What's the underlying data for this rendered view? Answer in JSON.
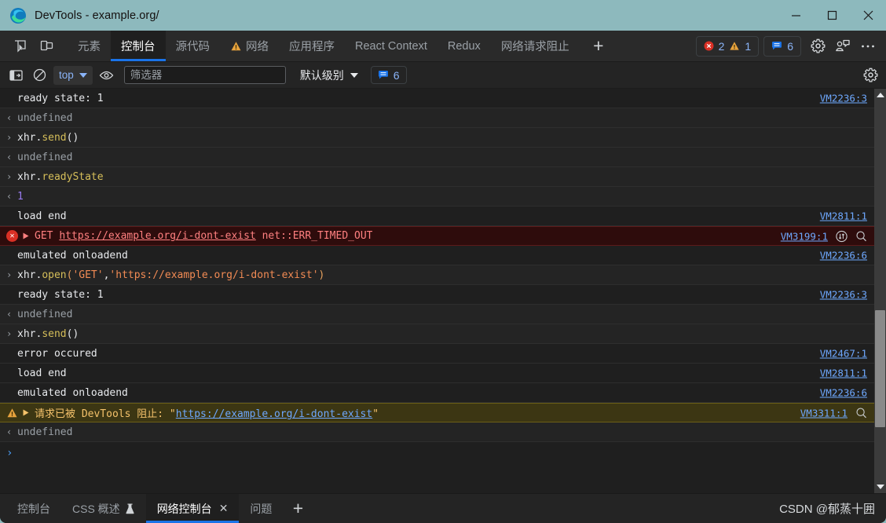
{
  "window": {
    "title": "DevTools - example.org/",
    "logo_icon": "edge-logo-icon",
    "minimize_label": "—",
    "maximize_label": "□",
    "close_label": "✕",
    "titlebar_color": "#8db9bd"
  },
  "tabstrip": {
    "inspect_icon": "inspect-element-icon",
    "device_icon": "device-toolbar-icon",
    "tabs": [
      {
        "label": "元素",
        "active": false,
        "icon": null
      },
      {
        "label": "控制台",
        "active": true,
        "icon": null
      },
      {
        "label": "源代码",
        "active": false,
        "icon": null
      },
      {
        "label": "网络",
        "active": false,
        "icon": "warning-triangle-icon"
      },
      {
        "label": "应用程序",
        "active": false,
        "icon": null
      },
      {
        "label": "React Context",
        "active": false,
        "icon": null
      },
      {
        "label": "Redux",
        "active": false,
        "icon": null
      },
      {
        "label": "网络请求阻止",
        "active": false,
        "icon": null
      }
    ],
    "add_tab_label": "+",
    "issues": {
      "error_icon": "error-circle-icon",
      "error_count": "2",
      "warning_icon": "warning-triangle-icon",
      "warning_count": "1"
    },
    "messages": {
      "icon": "message-bubble-icon",
      "count": "6"
    },
    "settings_icon": "gear-icon",
    "feedback_icon": "feedback-icon",
    "more_icon": "more-options-icon"
  },
  "console_toolbar": {
    "sidebar_icon": "console-sidebar-icon",
    "clear_icon": "clear-console-icon",
    "context_value": "top",
    "context_caret": "chevron-down-icon",
    "eye_icon": "live-expression-eye-icon",
    "filter_placeholder": "筛选器",
    "filter_value": "",
    "levels_label": "默认级别",
    "levels_caret": "chevron-down-icon",
    "messages_icon": "message-bubble-icon",
    "messages_count": "6",
    "settings_icon": "gear-icon"
  },
  "console_rows": [
    {
      "kind": "log",
      "text": "ready state: 1",
      "source": "VM2236:3"
    },
    {
      "kind": "result",
      "chevron": "‹",
      "text": "undefined",
      "source": ""
    },
    {
      "kind": "input",
      "chevron": "›",
      "tokens": [
        {
          "t": "xhr",
          "c": "tok-obj"
        },
        {
          "t": ".",
          "c": "tok-punc"
        },
        {
          "t": "send",
          "c": "tok-prop"
        },
        {
          "t": "()",
          "c": "tok-punc"
        }
      ],
      "source": ""
    },
    {
      "kind": "result",
      "chevron": "‹",
      "text": "undefined",
      "source": ""
    },
    {
      "kind": "input",
      "chevron": "›",
      "tokens": [
        {
          "t": "xhr",
          "c": "tok-obj"
        },
        {
          "t": ".",
          "c": "tok-punc"
        },
        {
          "t": "readyState",
          "c": "tok-prop"
        }
      ],
      "source": ""
    },
    {
      "kind": "result-num",
      "chevron": "‹",
      "text": "1",
      "source": ""
    },
    {
      "kind": "log",
      "text": "load end",
      "source": "VM2811:1"
    },
    {
      "kind": "error",
      "icon": "error-circle-icon",
      "expand_icon": "expand-triangle-icon",
      "prefix": "GET ",
      "url": "https://example.org/i-dont-exist",
      "suffix": " net::ERR_TIMED_OUT",
      "source": "VM3199:1",
      "extra_icons": [
        "network-request-icon",
        "search-icon"
      ]
    },
    {
      "kind": "log",
      "text": "emulated onloadend",
      "source": "VM2236:6"
    },
    {
      "kind": "input",
      "chevron": "›",
      "tokens": [
        {
          "t": "xhr",
          "c": "tok-obj"
        },
        {
          "t": ".",
          "c": "tok-punc"
        },
        {
          "t": "open",
          "c": "tok-prop"
        },
        {
          "t": "(",
          "c": "tok-paren"
        },
        {
          "t": "'GET'",
          "c": "tok-str"
        },
        {
          "t": ",",
          "c": "tok-punc"
        },
        {
          "t": "'https://example.org/i-dont-exist'",
          "c": "tok-str"
        },
        {
          "t": ")",
          "c": "tok-paren"
        }
      ],
      "source": ""
    },
    {
      "kind": "log",
      "text": "ready state: 1",
      "source": "VM2236:3"
    },
    {
      "kind": "result",
      "chevron": "‹",
      "text": "undefined",
      "source": ""
    },
    {
      "kind": "input",
      "chevron": "›",
      "tokens": [
        {
          "t": "xhr",
          "c": "tok-obj"
        },
        {
          "t": ".",
          "c": "tok-punc"
        },
        {
          "t": "send",
          "c": "tok-prop"
        },
        {
          "t": "()",
          "c": "tok-punc"
        }
      ],
      "source": ""
    },
    {
      "kind": "log",
      "text": "error occured",
      "source": "VM2467:1"
    },
    {
      "kind": "log",
      "text": "load end",
      "source": "VM2811:1"
    },
    {
      "kind": "log",
      "text": "emulated onloadend",
      "source": "VM2236:6"
    },
    {
      "kind": "warning",
      "icon": "warning-triangle-icon",
      "expand_icon": "expand-triangle-icon",
      "prefix": "请求已被 DevTools 阻止: \"",
      "url": "https://example.org/i-dont-exist",
      "suffix": "\"",
      "source": "VM3311:1",
      "extra_icons": [
        "search-icon"
      ]
    },
    {
      "kind": "result",
      "chevron": "‹",
      "text": "undefined",
      "source": ""
    },
    {
      "kind": "prompt",
      "chevron": "›",
      "text": "",
      "source": ""
    }
  ],
  "drawer": {
    "tabs": [
      {
        "label": "控制台",
        "active": false,
        "icon": null,
        "closable": false
      },
      {
        "label": "CSS 概述",
        "active": false,
        "icon": "flask-icon",
        "closable": false
      },
      {
        "label": "网络控制台",
        "active": true,
        "icon": null,
        "closable": true
      },
      {
        "label": "问题",
        "active": false,
        "icon": null,
        "closable": false
      }
    ],
    "add_label": "+",
    "close_label": "✕",
    "watermark": "CSDN @郁蒸十囲"
  },
  "scrollbar": {
    "up_icon": "scroll-up-arrow-icon",
    "down_icon": "scroll-down-arrow-icon",
    "thumb": "scrollbar-thumb"
  },
  "colors": {
    "accent_blue": "#1a73e8",
    "link_blue": "#6ea8fe",
    "error_red": "#d93025",
    "warning_orange": "#e8a33d",
    "titlebar": "#8db9bd"
  }
}
